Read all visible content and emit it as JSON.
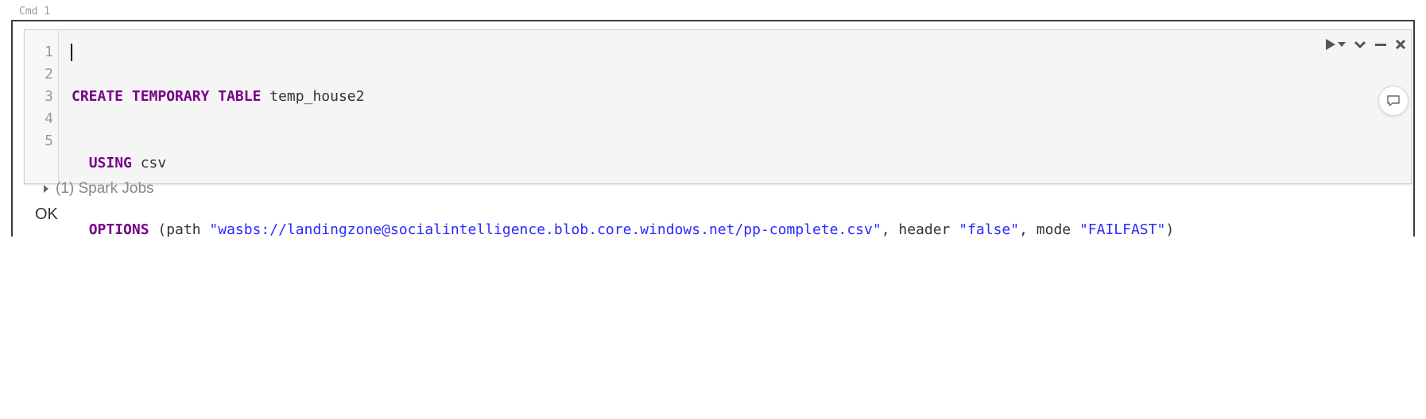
{
  "cmd": {
    "label": "Cmd 1"
  },
  "editor": {
    "line_numbers": [
      "1",
      "2",
      "3",
      "4",
      "5"
    ],
    "code": {
      "line1": {
        "kw": "CREATE TEMPORARY TABLE",
        "rest": " temp_house2"
      },
      "line2": {
        "indent": "  ",
        "kw": "USING",
        "rest": " csv"
      },
      "line3": {
        "indent": "  ",
        "kw": "OPTIONS",
        "t1": " (path ",
        "s1": "\"wasbs://landingzone@socialintelligence.blob.core.windows.net/pp-complete.csv\"",
        "t2": ", header ",
        "s2": "\"false\"",
        "t3": ", mode ",
        "s3": "\"FAILFAST\"",
        "t4": ")"
      }
    }
  },
  "toolbar": {
    "icons": [
      "run-icon",
      "run-dropdown-icon",
      "collapse-icon",
      "minimize-icon",
      "close-icon"
    ]
  },
  "comment": {
    "icon": "comment-icon"
  },
  "output": {
    "spark_jobs": "(1) Spark Jobs",
    "result": "OK"
  },
  "colors": {
    "keyword": "#770088",
    "string": "#2a2aff",
    "cell_border": "#3b3b3b"
  }
}
